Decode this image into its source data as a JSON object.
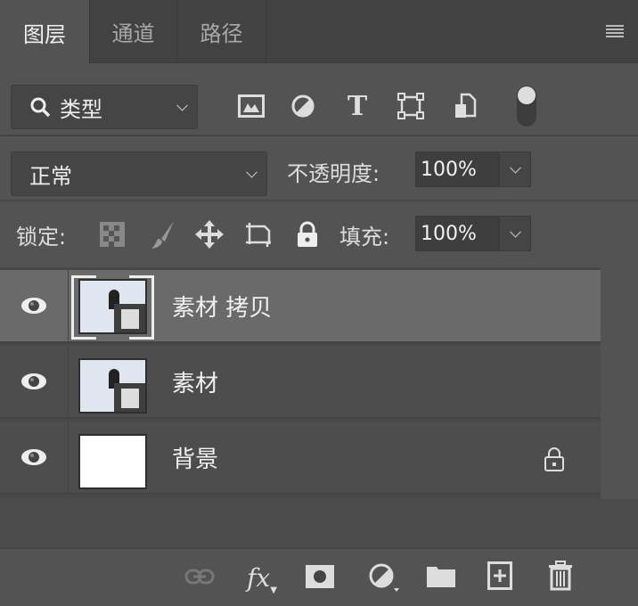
{
  "tabs": [
    {
      "label": "图层",
      "active": true
    },
    {
      "label": "通道",
      "active": false
    },
    {
      "label": "路径",
      "active": false
    }
  ],
  "filter": {
    "kind_label": "类型",
    "icons": [
      "image-filter-icon",
      "adjustment-filter-icon",
      "type-filter-icon",
      "shape-filter-icon",
      "smart-object-filter-icon"
    ]
  },
  "blend": {
    "mode": "正常",
    "opacity_label": "不透明度:",
    "opacity": "100%"
  },
  "lock": {
    "label": "锁定:",
    "fill_label": "填充:",
    "fill": "100%"
  },
  "layers": [
    {
      "name": "素材 拷贝",
      "selected": true,
      "visible": true,
      "smart_object": true,
      "locked": false
    },
    {
      "name": "素材",
      "selected": false,
      "visible": true,
      "smart_object": true,
      "locked": false
    },
    {
      "name": "背景",
      "selected": false,
      "visible": true,
      "smart_object": false,
      "locked": true
    }
  ],
  "colors": {
    "panel": "#535353",
    "selected_row": "#6a6a6a",
    "tabbar": "#424242"
  }
}
